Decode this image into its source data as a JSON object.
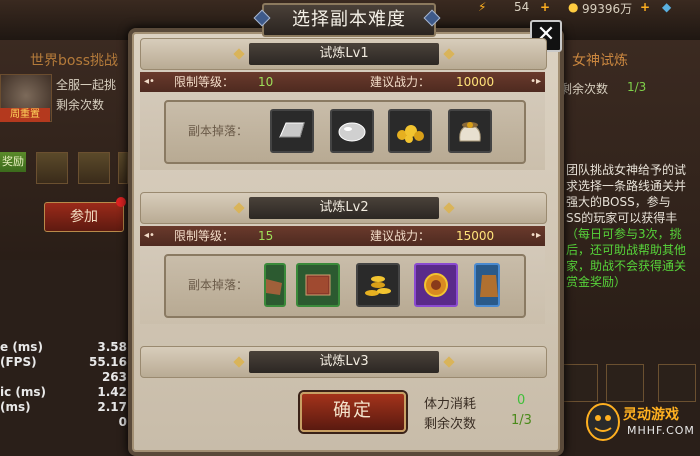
{
  "dialog": {
    "title": "选择副本难度",
    "close_label": "✕",
    "confirm_label": "确定",
    "stamina_label": "体力消耗",
    "stamina_value": "0",
    "remaining_label": "剩余次数",
    "remaining_value": "1/3"
  },
  "levels": [
    {
      "name": "试炼Lv1",
      "req_level_label": "限制等级：",
      "req_level": "10",
      "power_label": "建议战力：",
      "power": "10000",
      "drop_label": "副本掉落：",
      "drops": [
        "silver-bar-icon",
        "silver-ore-icon",
        "gold-nuggets-icon",
        "gold-bag-icon"
      ]
    },
    {
      "name": "试炼Lv2",
      "req_level_label": "限制等级：",
      "req_level": "15",
      "power_label": "建议战力：",
      "power": "15000",
      "drop_label": "副本掉落：",
      "drops": [
        "leather-icon",
        "book-icon",
        "gold-coins-icon",
        "badge-icon",
        "armor-icon"
      ]
    },
    {
      "name": "试炼Lv3"
    }
  ],
  "background": {
    "top_resource_1": "54",
    "top_resource_2": "99396万",
    "left_title": "世界boss挑战",
    "left_line1": "全服一起挑",
    "left_line2": "剩余次数",
    "left_portrait_tag": "周重置",
    "left_reward_tag": "奖励",
    "join_button": "参加",
    "stats": [
      {
        "label": "e (ms)",
        "value": "3.58"
      },
      {
        "label": "(FPS)",
        "value": "55.16"
      },
      {
        "label": "",
        "value": "263"
      },
      {
        "label": "ic (ms)",
        "value": "1.42"
      },
      {
        "label": "(ms)",
        "value": "2.17"
      },
      {
        "label": "",
        "value": "0"
      }
    ],
    "right_title": "女神试炼",
    "right_remaining_label": "剩余次数",
    "right_remaining_value": "1/3",
    "right_desc": [
      {
        "text": "团队挑战女神给予的试",
        "color": "#e8e2d8"
      },
      {
        "text": "求选择一条路线通关并",
        "color": "#e8e2d8"
      },
      {
        "text": "强大的BOSS，参与",
        "color": "#e8e2d8"
      },
      {
        "text": "SS的玩家可以获得丰",
        "color": "#e8e2d8"
      },
      {
        "text": "（每日可参与3次，挑",
        "color": "#57d43a"
      },
      {
        "text": "后，还可助战帮助其他",
        "color": "#57d43a"
      },
      {
        "text": "家，助战不会获得通关",
        "color": "#57d43a"
      },
      {
        "text": "赏金奖励）",
        "color": "#57d43a"
      }
    ],
    "logo_main": "灵动游戏",
    "logo_sub": "MHHF.COM"
  }
}
